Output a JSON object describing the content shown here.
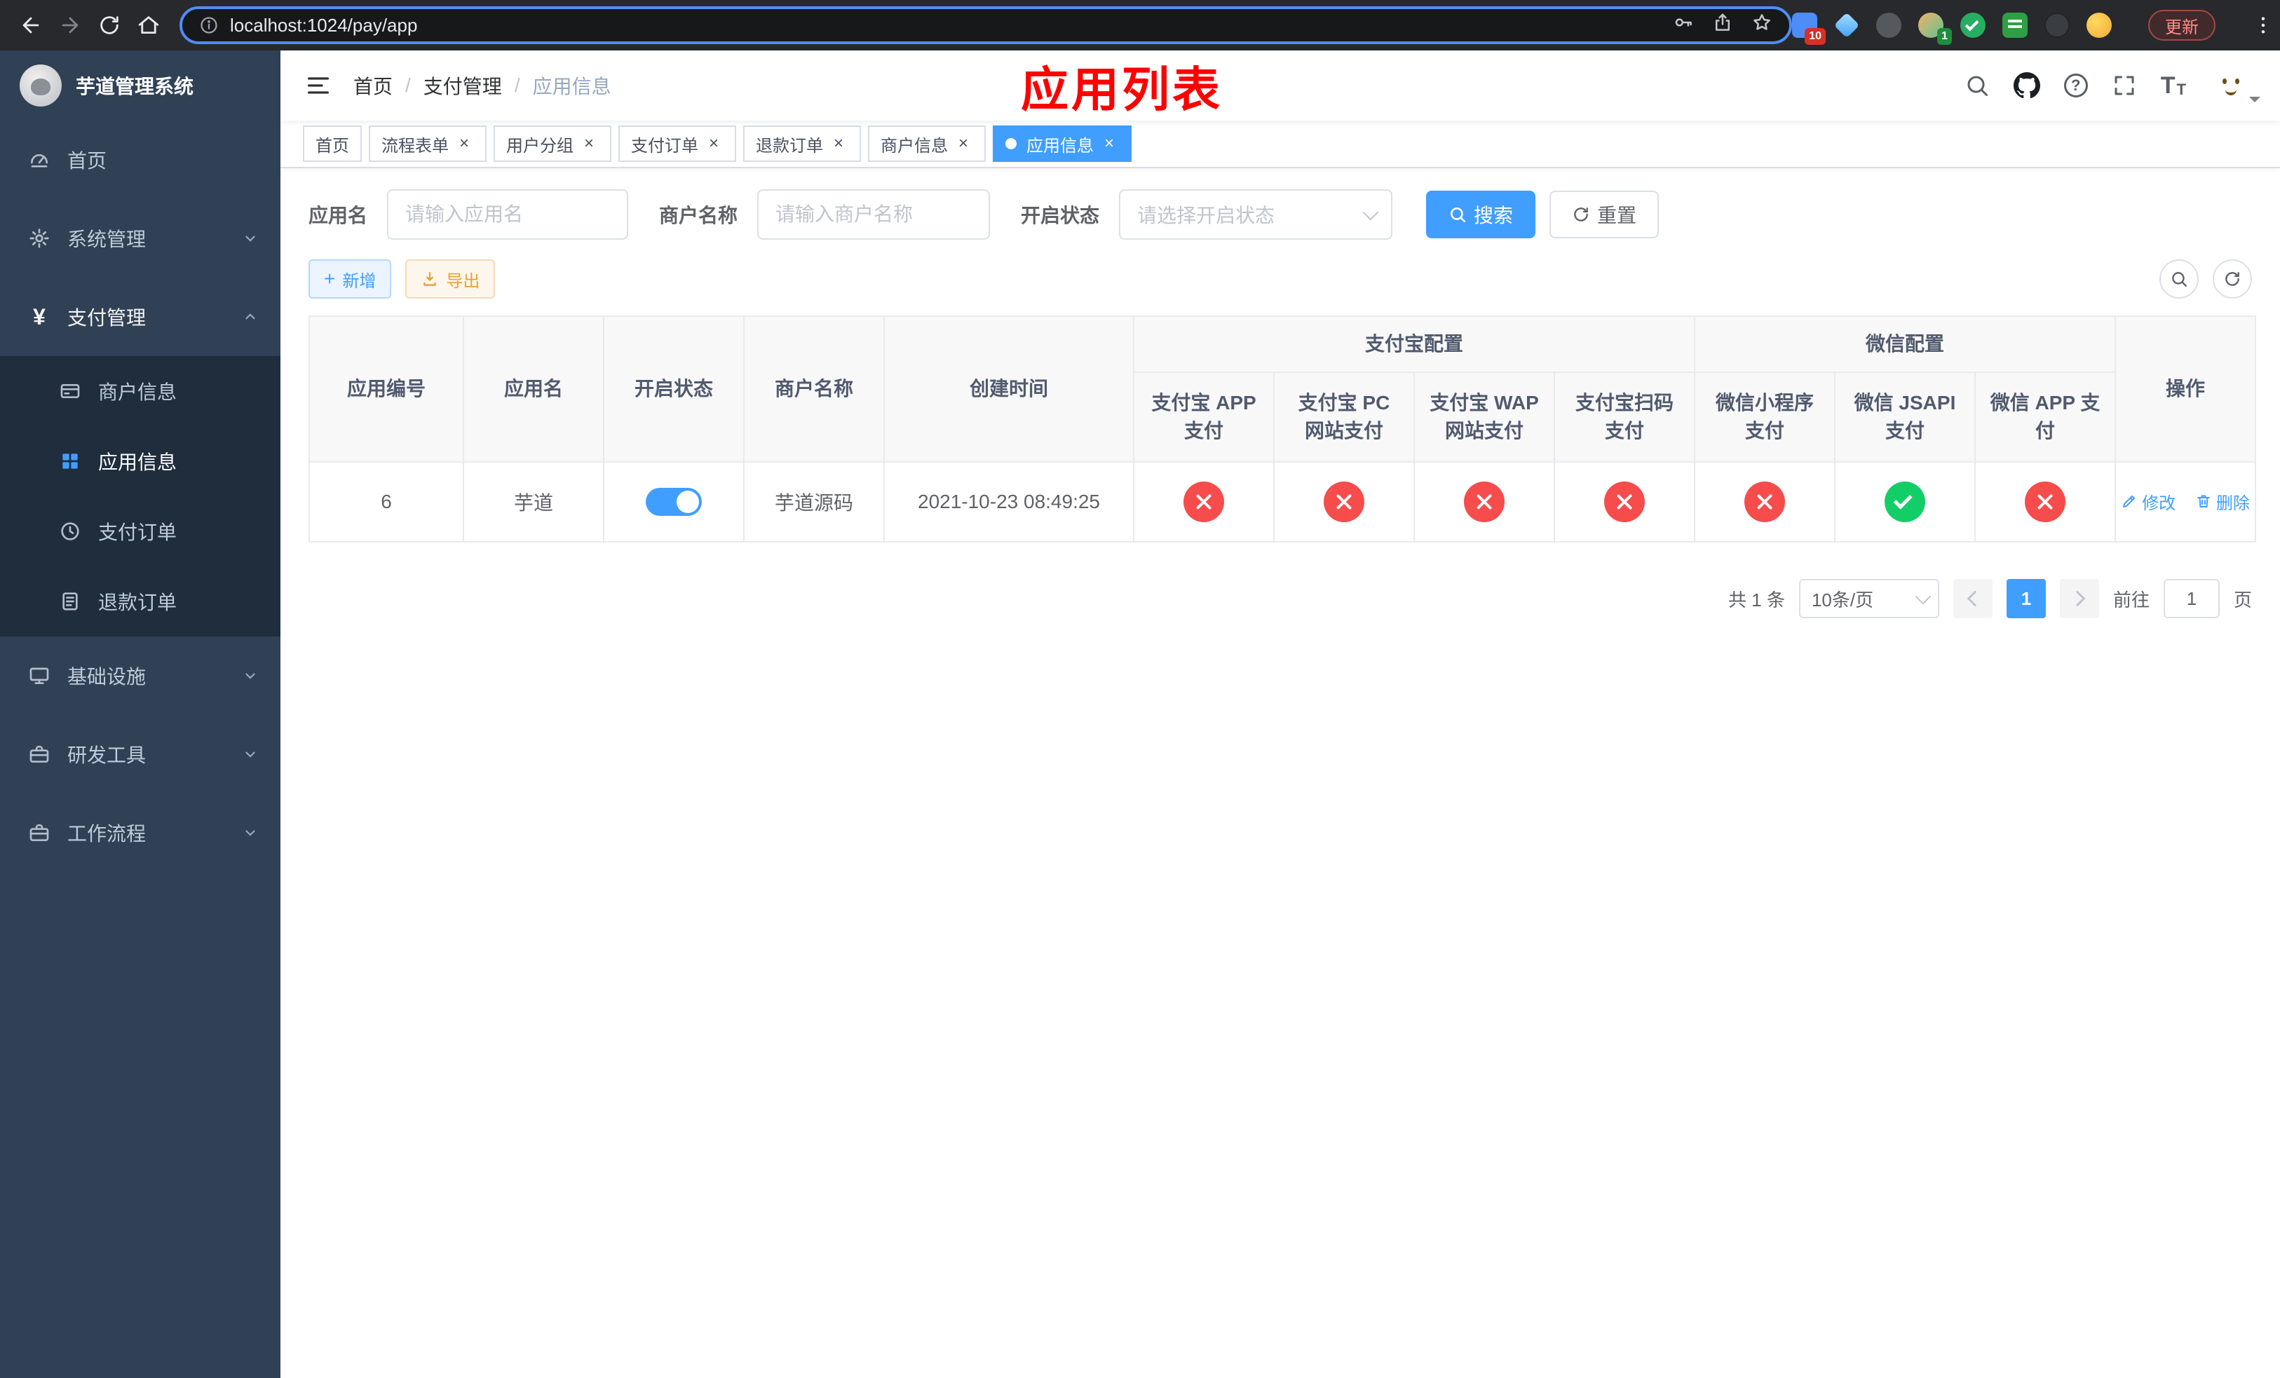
{
  "colors": {
    "accent": "#409eff",
    "danger": "#f64c4c",
    "success": "#13ce66",
    "warning": "#e6a23c",
    "sidebar_bg": "#304156",
    "annotation": "#ff0000"
  },
  "glyphs": {
    "close": "×",
    "plus": "+",
    "yen": "¥",
    "question": "?",
    "slash": "/",
    "t_large": "T",
    "t_small": "T"
  },
  "browser": {
    "url": "localhost:1024/pay/app",
    "update": "更新",
    "badge_ext": "10",
    "badge_profile": "1"
  },
  "sidebar": {
    "title": "芋道管理系统",
    "menu_home": "首页",
    "menu_system": "系统管理",
    "menu_pay": "支付管理",
    "menu_infra": "基础设施",
    "menu_dev": "研发工具",
    "menu_flow": "工作流程",
    "submenu": {
      "merchant": "商户信息",
      "app": "应用信息",
      "order": "支付订单",
      "refund": "退款订单"
    }
  },
  "navbar": {
    "breadcrumb": [
      "首页",
      "支付管理",
      "应用信息"
    ],
    "annotation": "应用列表"
  },
  "tabs": [
    {
      "label": "首页"
    },
    {
      "label": "流程表单"
    },
    {
      "label": "用户分组"
    },
    {
      "label": "支付订单"
    },
    {
      "label": "退款订单"
    },
    {
      "label": "商户信息"
    },
    {
      "label": "应用信息"
    }
  ],
  "filters": {
    "app_name_label": "应用名",
    "app_name_placeholder": "请输入应用名",
    "merchant_label": "商户名称",
    "merchant_placeholder": "请输入商户名称",
    "status_label": "开启状态",
    "status_placeholder": "请选择开启状态",
    "search": "搜索",
    "reset": "重置"
  },
  "toolbar": {
    "add": "新增",
    "export": "导出"
  },
  "table": {
    "headers": {
      "app_id": "应用编号",
      "app_name": "应用名",
      "status": "开启状态",
      "merchant": "商户名称",
      "created": "创建时间",
      "alipay_group": "支付宝配置",
      "wechat_group": "微信配置",
      "alipay_app": "支付宝 APP 支付",
      "alipay_pc": "支付宝 PC 网站支付",
      "alipay_wap": "支付宝 WAP 网站支付",
      "alipay_qr": "支付宝扫码支付",
      "wechat_mini": "微信小程序支付",
      "wechat_jsapi": "微信 JSAPI 支付",
      "wechat_app": "微信 APP 支付",
      "actions": "操作"
    },
    "row": {
      "id": "6",
      "name": "芋道",
      "enabled": true,
      "merchant": "芋道源码",
      "created": "2021-10-23 08:49:25",
      "configs": {
        "alipay_app": false,
        "alipay_pc": false,
        "alipay_wap": false,
        "alipay_qr": false,
        "wechat_mini": false,
        "wechat_jsapi": true,
        "wechat_app": false
      },
      "edit": "修改",
      "remove": "删除"
    }
  },
  "pagination": {
    "total": "共 1 条",
    "size": "10条/页",
    "page": "1",
    "goto": "前往",
    "goto_value": "1",
    "unit": "页"
  }
}
